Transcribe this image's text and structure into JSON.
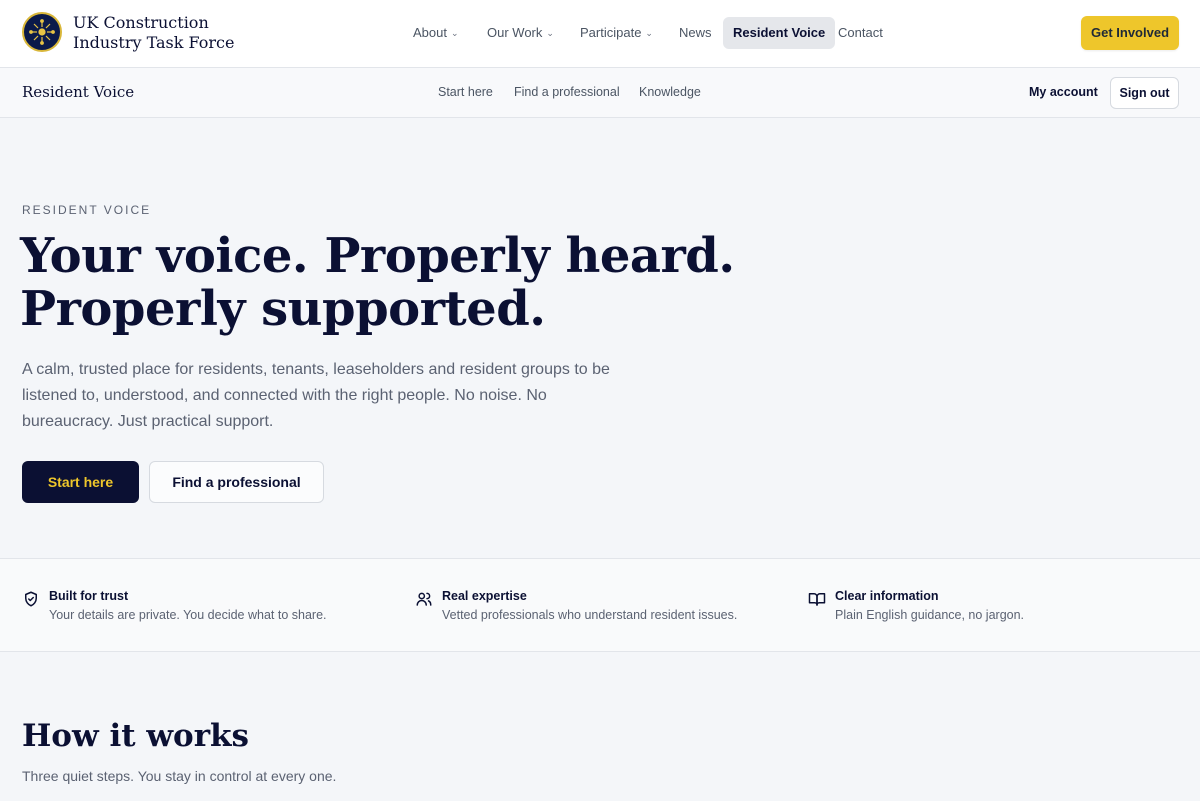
{
  "header": {
    "org_name": "UK Construction Industry Task Force",
    "nav": [
      {
        "label": "About",
        "has_menu": true
      },
      {
        "label": "Our Work",
        "has_menu": true
      },
      {
        "label": "Participate",
        "has_menu": true
      },
      {
        "label": "News",
        "has_menu": false
      },
      {
        "label": "Resident Voice",
        "has_menu": false,
        "active": true
      },
      {
        "label": "Contact",
        "has_menu": false
      }
    ],
    "cta_label": "Get Involved"
  },
  "subnav": {
    "title": "Resident Voice",
    "links": [
      "Start here",
      "Find a professional",
      "Knowledge"
    ],
    "account_label": "My account",
    "signout_label": "Sign out"
  },
  "hero": {
    "eyebrow": "RESIDENT VOICE",
    "title_line1": "Your voice. Properly heard.",
    "title_line2": "Properly supported.",
    "body": "A calm, trusted place for residents, tenants, leaseholders and resident groups to be listened to, understood, and connected with the right people. No noise. No bureaucracy. Just practical support.",
    "primary_label": "Start here",
    "secondary_label": "Find a professional"
  },
  "features": [
    {
      "icon": "shield-check-icon",
      "title": "Built for trust",
      "desc": "Your details are private. You decide what to share."
    },
    {
      "icon": "users-icon",
      "title": "Real expertise",
      "desc": "Vetted professionals who understand resident issues."
    },
    {
      "icon": "book-open-icon",
      "title": "Clear information",
      "desc": "Plain English guidance, no jargon."
    }
  ],
  "how_it_works": {
    "title": "How it works",
    "subtitle": "Three quiet steps. You stay in control at every one."
  },
  "colors": {
    "navy": "#0b1033",
    "gold": "#eec62b",
    "muted": "#5b6272"
  }
}
